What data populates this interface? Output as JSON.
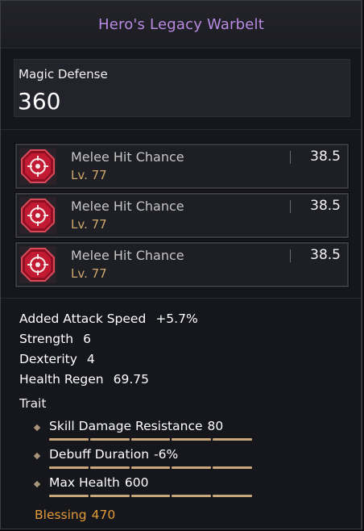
{
  "item": {
    "name": "Hero's Legacy Warbelt",
    "name_color": "#b98ae2"
  },
  "main_stat": {
    "label": "Magic Defense",
    "value": "360"
  },
  "sub_stats": [
    {
      "name": "Melee Hit Chance",
      "level": "Lv. 77",
      "value": "38.5",
      "icon": "crosshair-gem-icon"
    },
    {
      "name": "Melee Hit Chance",
      "level": "Lv. 77",
      "value": "38.5",
      "icon": "crosshair-gem-icon"
    },
    {
      "name": "Melee Hit Chance",
      "level": "Lv. 77",
      "value": "38.5",
      "icon": "crosshair-gem-icon"
    }
  ],
  "stats": [
    {
      "name": "Added Attack Speed",
      "value": "+5.7%"
    },
    {
      "name": "Strength",
      "value": "6"
    },
    {
      "name": "Dexterity",
      "value": "4"
    },
    {
      "name": "Health Regen",
      "value": "69.75"
    }
  ],
  "trait": {
    "title": "Trait",
    "items": [
      {
        "name": "Skill Damage Resistance",
        "value": "80",
        "pips": 5
      },
      {
        "name": "Debuff Duration",
        "value": "-6%",
        "pips": 5
      },
      {
        "name": "Max Health",
        "value": "600",
        "pips": 5
      }
    ]
  },
  "blessing": {
    "label": "Blessing",
    "value": "470",
    "color": "#e39a3a"
  },
  "colors": {
    "level_text": "#cfa86d",
    "trait_bar": "#c8a77a",
    "icon_red": "#b3122a"
  }
}
